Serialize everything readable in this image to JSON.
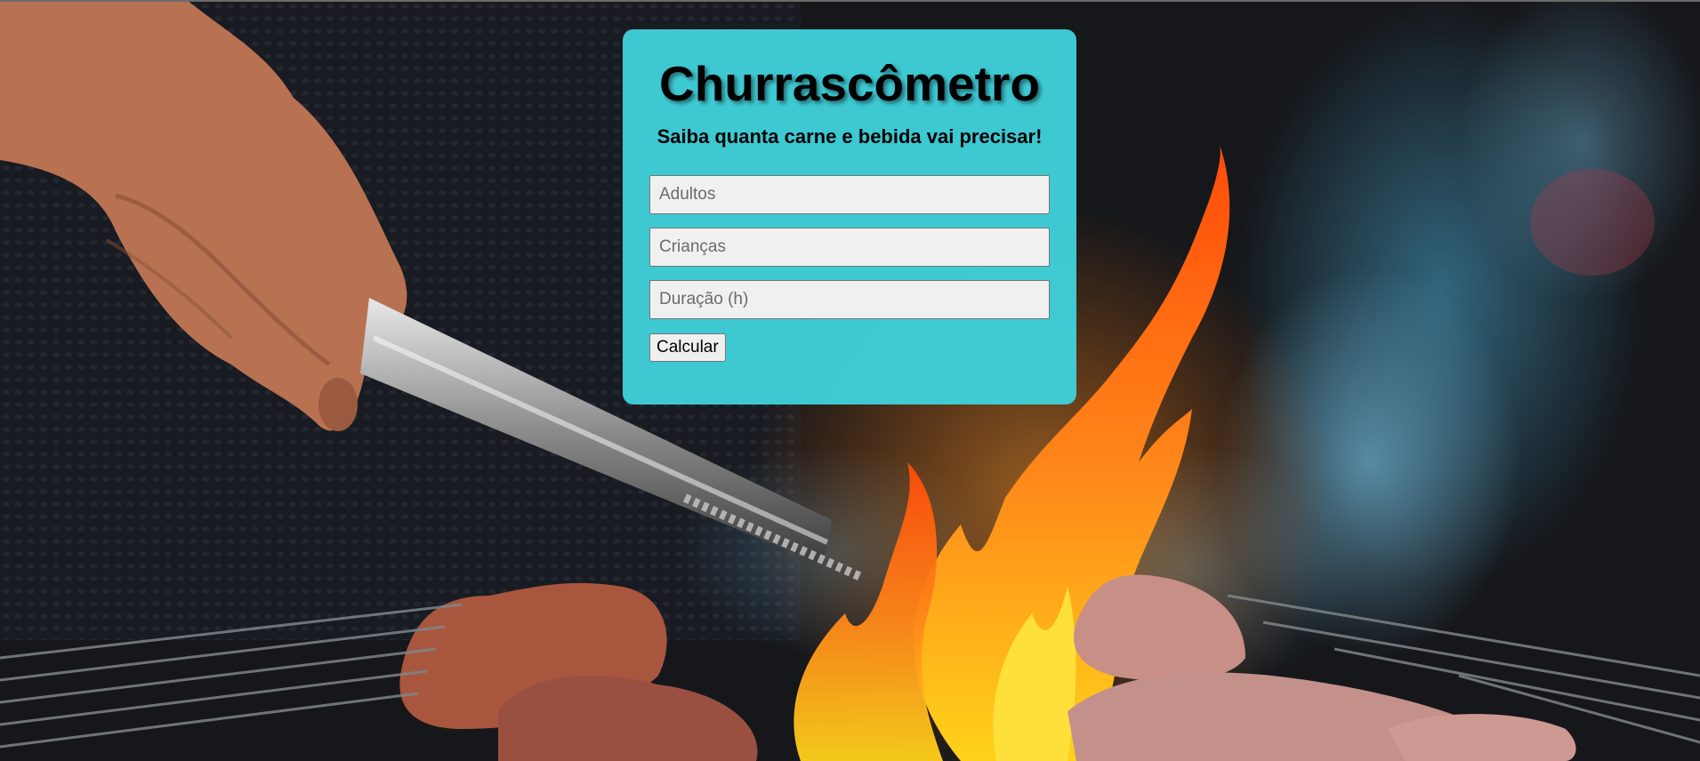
{
  "header": {
    "title": "Churrascômetro",
    "subtitle": "Saiba quanta carne e bebida vai precisar!"
  },
  "form": {
    "adults": {
      "value": "",
      "placeholder": "Adultos"
    },
    "children": {
      "value": "",
      "placeholder": "Crianças"
    },
    "duration": {
      "value": "",
      "placeholder": "Duração (h)"
    },
    "submit_label": "Calcular"
  },
  "colors": {
    "card_background": "#40d0da",
    "title_text": "#000000"
  }
}
